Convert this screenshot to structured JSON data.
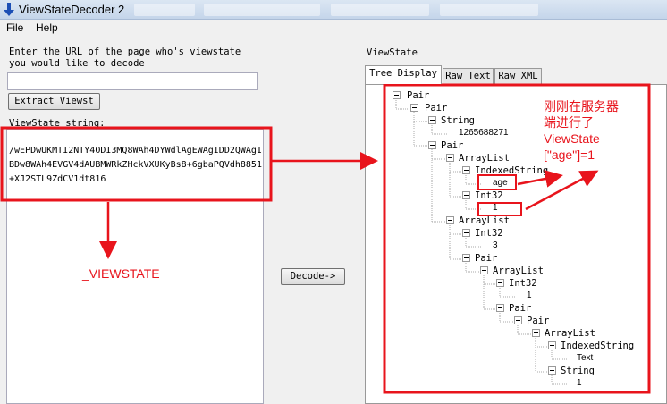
{
  "window": {
    "title": "ViewStateDecoder 2"
  },
  "menu": {
    "file": "File",
    "help": "Help"
  },
  "left": {
    "url_label_line1": "Enter the URL of the page who's viewstate",
    "url_label_line2": "you would like to decode",
    "url_value": "",
    "extract_button": "Extract Viewst",
    "viewstate_label": "ViewState string:",
    "viewstate_value": "/wEPDwUKMTI2NTY4ODI3MQ8WAh4DYWdlAgEWAgIDD2QWAgIBDw8WAh4EVGV4dAUBMWRkZHckVXUKyBs8+6gbaPQVdh8851+XJ2STL9ZdCV1dt816"
  },
  "middle": {
    "decode_button": "Decode->"
  },
  "right": {
    "viewstate_label": "ViewState",
    "tabs": [
      "Tree Display",
      "Raw Text",
      "Raw XML"
    ],
    "tree": {
      "n1": "Pair",
      "n2": "Pair",
      "n3": "String",
      "n4": "1265688271",
      "n5": "Pair",
      "n6": "ArrayList",
      "n7": "IndexedString",
      "n8": "age",
      "n9": "Int32",
      "n10": "1",
      "n11": "ArrayList",
      "n12": "Int32",
      "n13": "3",
      "n14": "Pair",
      "n15": "ArrayList",
      "n16": "Int32",
      "n17": "1",
      "n18": "Pair",
      "n19": "Pair",
      "n20": "ArrayList",
      "n21": "IndexedString",
      "n22": "Text",
      "n23": "String",
      "n24": "1"
    }
  },
  "annotations": {
    "viewstate_name": "_VIEWSTATE",
    "note_line1": "刚刚在服务器",
    "note_line2": "端进行了",
    "note_line3": "ViewState",
    "note_line4": "[\"age\"]=1"
  },
  "colors": {
    "annotation_red": "#e8141c",
    "title_icon_blue": "#1c4fb5"
  }
}
